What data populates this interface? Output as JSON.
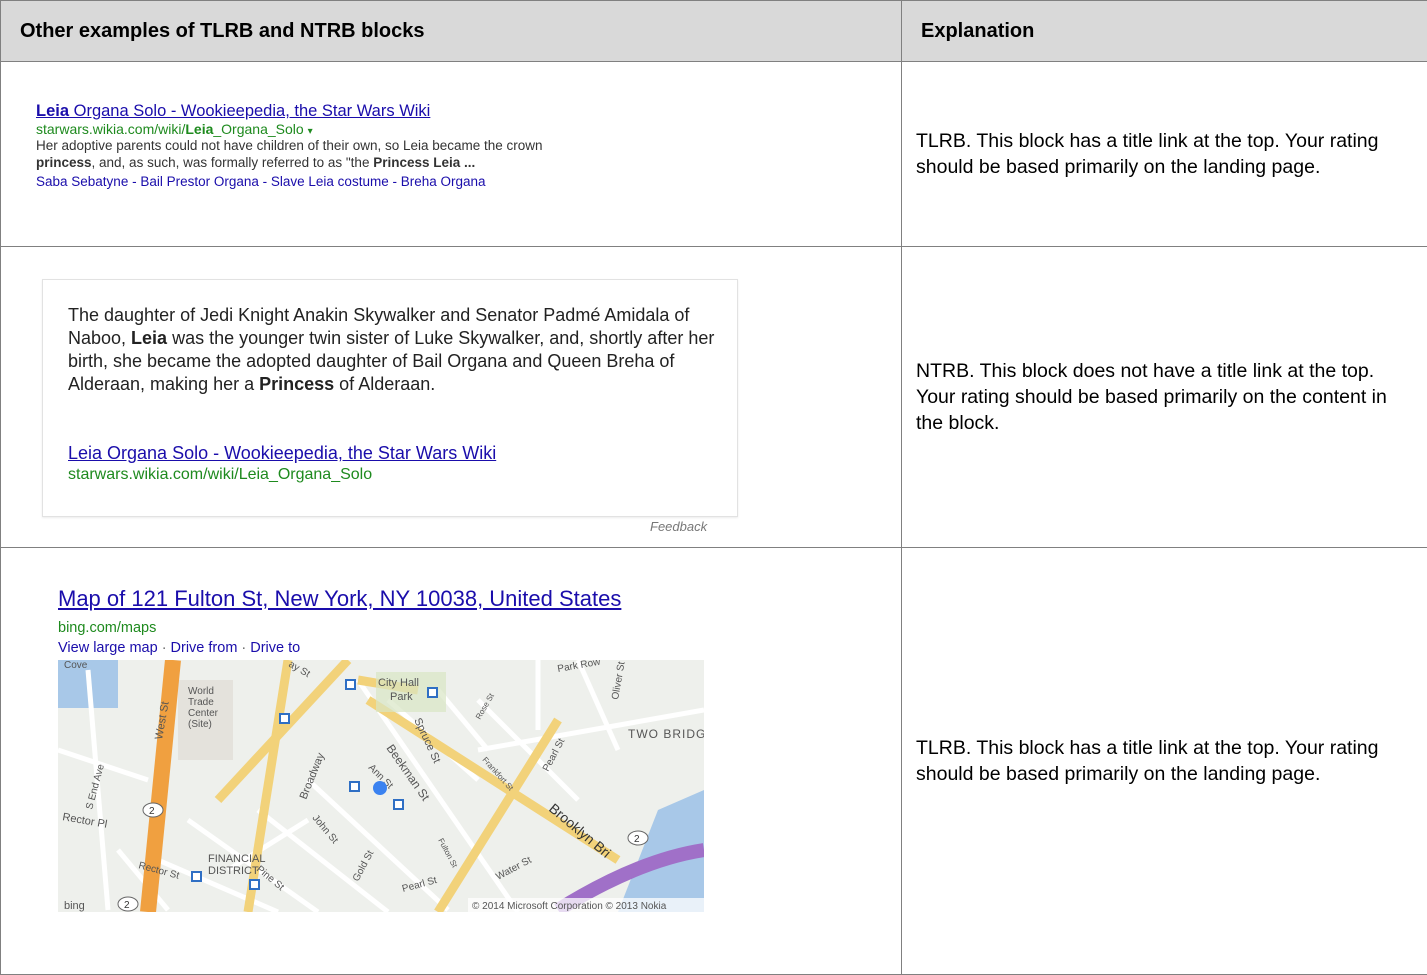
{
  "header": {
    "col1": "Other examples of TLRB and NTRB blocks",
    "col2": "Explanation"
  },
  "row1": {
    "title_bold": "Leia",
    "title_rest": " Organa Solo - Wookieepedia, the Star Wars Wiki",
    "url_pre": "starwars.wikia.com/wiki/",
    "url_bold": "Leia",
    "url_post": "_Organa_Solo",
    "url_arrow": "▾",
    "snippet_1": "Her adoptive parents could not have children of their own, so Leia became the crown",
    "snippet_2_bold": "princess",
    "snippet_2_rest": ", and, as such, was formally referred to as \"the ",
    "snippet_2_bold2": "Princess Leia",
    "snippet_2_end": " ...",
    "sublinks": [
      "Saba Sebatyne",
      "Bail Prestor Organa",
      "Slave Leia costume",
      "Breha Organa"
    ],
    "sublink_sep": " - ",
    "explanation": "TLRB.  This block has a title link at the top.  Your rating should be based primarily on the landing page."
  },
  "row2": {
    "answer_1": "The daughter of Jedi Knight Anakin Skywalker and Senator Padmé Amidala of Naboo, ",
    "answer_bold1": "Leia",
    "answer_2": " was the younger twin sister of Luke Skywalker, and, shortly after her birth, she became the adopted daughter of Bail Organa and Queen Breha of Alderaan, making her a ",
    "answer_bold2": "Princess",
    "answer_3": " of Alderaan.",
    "link": "Leia Organa Solo - Wookieepedia, the Star Wars Wiki",
    "url": "starwars.wikia.com/wiki/Leia_Organa_Solo",
    "feedback": "Feedback",
    "explanation": "NTRB.  This block does not have a title link at the top.  Your rating should be based primarily on the content in the block."
  },
  "row3": {
    "title": "Map of 121 Fulton St, New York, NY 10038, United States",
    "url": "bing.com/maps",
    "links": [
      "View large map",
      "Drive from",
      "Drive to"
    ],
    "link_sep": "·",
    "map_labels": {
      "cove": "Cove",
      "wtc": [
        "World",
        "Trade",
        "Center",
        "(Site)"
      ],
      "city_hall": [
        "City Hall",
        "Park"
      ],
      "two_bridges": "TWO BRIDG",
      "financial": [
        "FINANCIAL",
        "DISTRICT"
      ],
      "west_st": "West St",
      "broadway": "Broadway",
      "beekman": "Beekman St",
      "spruce": "Spruce St",
      "ann": "Ann St",
      "john": "John St",
      "pearl": "Pearl St",
      "pearl2": "Pearl St",
      "water": "Water St",
      "gold": "Gold St",
      "pine": "Pine St",
      "rector": "Rector Pl",
      "rector2": "Rector St",
      "s_end": "S End Ave",
      "frankfort": "Frankfort St",
      "rose": "Rose St",
      "oliver": "Oliver St",
      "park_row": "Park Row",
      "brooklyn": "Brooklyn Bri",
      "murray": "ay St",
      "fulton": "Fulton St",
      "route2": "2",
      "copyright": "© 2014 Microsoft Corporation © 2013 Nokia",
      "bing": "bing"
    },
    "explanation": "TLRB.  This block has a title link at the top.  Your rating should be based primarily on the landing page."
  }
}
